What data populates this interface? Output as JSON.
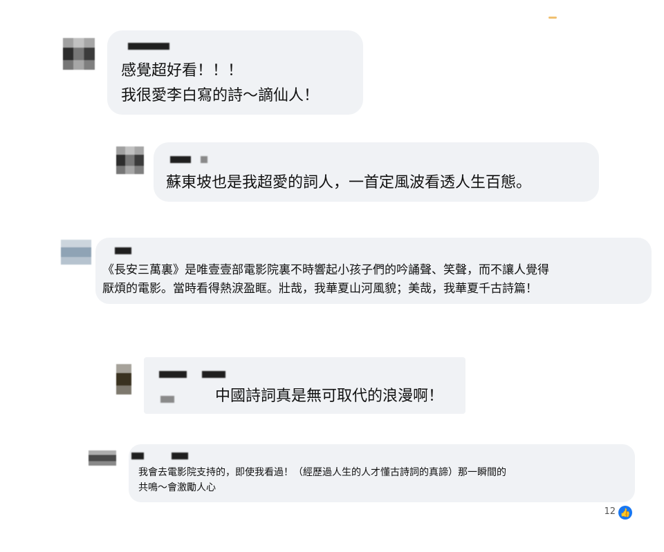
{
  "comments": [
    {
      "lines": [
        "感覺超好看！！！",
        "我很愛李白寫的詩～謫仙人！"
      ]
    },
    {
      "lines": [
        "蘇東坡也是我超愛的詞人，一首定風波看透人生百態。"
      ]
    },
    {
      "lines": [
        "《長安三萬裏》是唯壹壹部電影院裏不時響起小孩子們的吟誦聲、笑聲，而不讓人覺得",
        "厭煩的電影。當時看得熱淚盈眶。壯哉，我華夏山河風貌；美哉，我華夏千古詩篇！"
      ]
    },
    {
      "lines": [
        "中國詩詞真是無可取代的浪漫啊！"
      ]
    },
    {
      "lines": [
        "我會去電影院支持的，即使我看過！（經歷過人生的人才懂古詩詞的真諦）那一瞬間的",
        "共鳴～會激勵人心"
      ]
    }
  ],
  "reactions": {
    "count": "12",
    "icon": "like-icon"
  }
}
